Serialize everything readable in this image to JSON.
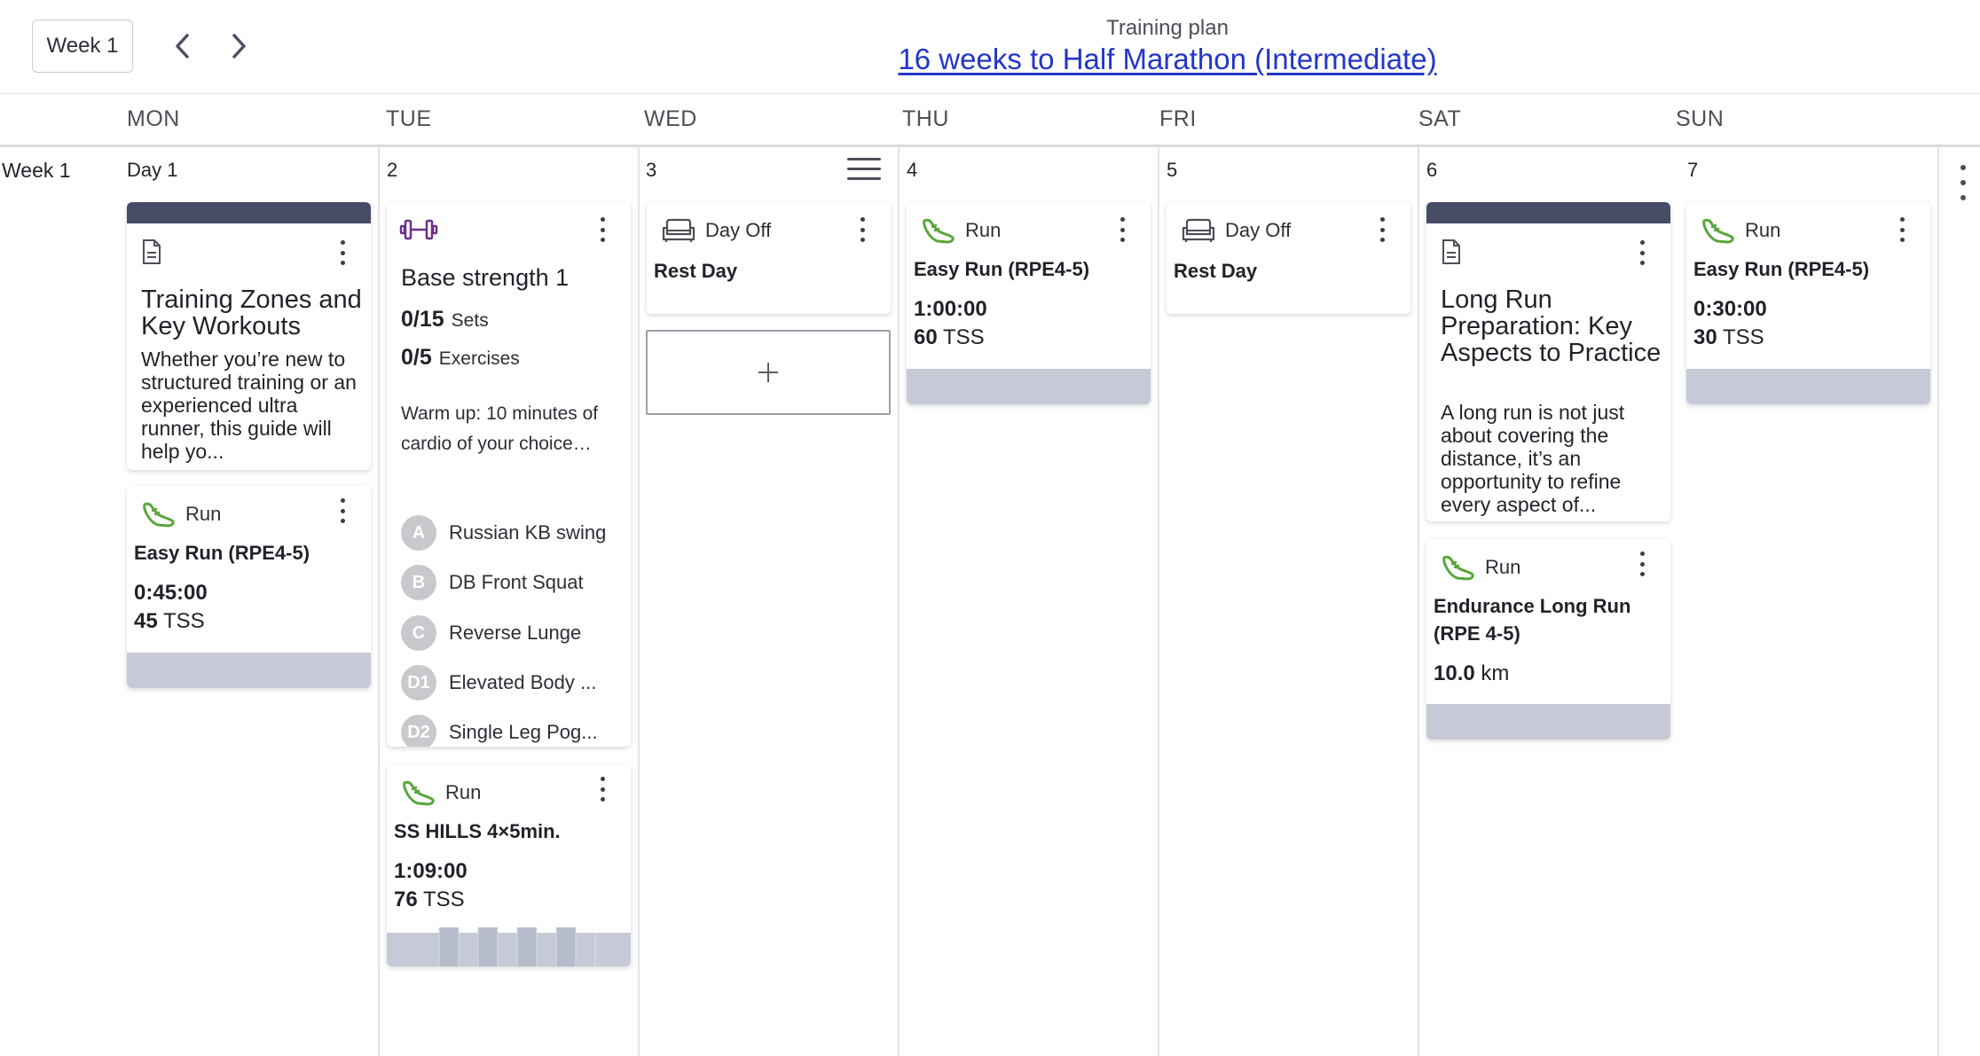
{
  "header": {
    "week_selector": "Week 1",
    "plan_label": "Training plan",
    "plan_title": "16 weeks to Half Marathon (Intermediate)"
  },
  "days": [
    "MON",
    "TUE",
    "WED",
    "THU",
    "FRI",
    "SAT",
    "SUN"
  ],
  "week_row": {
    "label": "Week 1",
    "day_numbers": [
      "Day 1",
      "2",
      "3",
      "4",
      "5",
      "6",
      "7"
    ]
  },
  "cards": {
    "mon_doc": {
      "icon": "document-icon",
      "title": "Training Zones and Key Workouts",
      "text": "Whether you’re new to structured training or an experienced ultra runner, this guide will help yo..."
    },
    "mon_run": {
      "type": "Run",
      "title": "Easy Run (RPE4-5)",
      "duration": "0:45:00",
      "tss_value": "45",
      "tss_unit": "TSS"
    },
    "tue_strength": {
      "icon": "dumbbell-icon",
      "title": "Base strength 1",
      "sets_value": "0/15",
      "sets_label": "Sets",
      "exercises_value": "0/5",
      "exercises_label": "Exercises",
      "warmup": "Warm up: 10 minutes of cardio of your choice…",
      "exercises": [
        {
          "badge": "A",
          "name": "Russian KB swing"
        },
        {
          "badge": "B",
          "name": "DB Front Squat"
        },
        {
          "badge": "C",
          "name": "Reverse Lunge"
        },
        {
          "badge": "D1",
          "name": "Elevated Body ..."
        },
        {
          "badge": "D2",
          "name": "Single Leg Pog..."
        }
      ]
    },
    "tue_run": {
      "type": "Run",
      "title": "SS HILLS 4×5min.",
      "duration": "1:09:00",
      "tss_value": "76",
      "tss_unit": "TSS"
    },
    "wed_off": {
      "type": "Day Off",
      "title": "Rest Day"
    },
    "wed_add": {
      "icon": "plus-icon"
    },
    "thu_run": {
      "type": "Run",
      "title": "Easy Run (RPE4-5)",
      "duration": "1:00:00",
      "tss_value": "60",
      "tss_unit": "TSS"
    },
    "fri_off": {
      "type": "Day Off",
      "title": "Rest Day"
    },
    "sat_doc": {
      "icon": "document-icon",
      "title": "Long Run Preparation: Key Aspects to Practice",
      "text": "A long run is not just about covering the distance, it’s an opportunity to refine every aspect of..."
    },
    "sat_run": {
      "type": "Run",
      "title": "Endurance Long Run (RPE 4-5)",
      "distance_value": "10.0",
      "distance_unit": "km"
    },
    "sun_run": {
      "type": "Run",
      "title": "Easy Run (RPE4-5)",
      "duration": "0:30:00",
      "tss_value": "30",
      "tss_unit": "TSS"
    }
  },
  "colors": {
    "link": "#2336c8",
    "run_icon": "#5aa63a",
    "strength_icon": "#6b2f8a",
    "card_header": "#454c66",
    "card_footer": "#c5cad6"
  }
}
